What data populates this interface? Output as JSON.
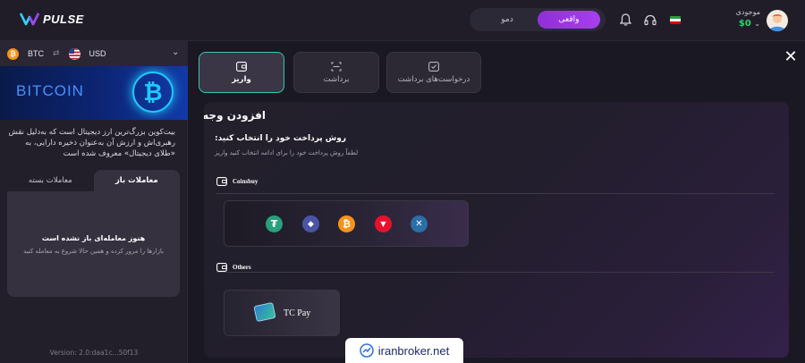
{
  "header": {
    "logo_text": "PULSE",
    "mode_demo": "دمو",
    "mode_real": "واقعی",
    "balance_label": "موجودی",
    "balance_value": "$0"
  },
  "sidebar": {
    "base_coin": "BTC",
    "quote_currency": "USD",
    "banner_title": "BITCOIN",
    "description": "بیت‌کوین بزرگ‌ترین ارز دیجیتال است که به‌دلیل نقش رهبری‌اش و ارزش آن به‌عنوان ذخیره دارایی، به «طلای دیجیتال» معروف شده است",
    "tabs": [
      {
        "label": "معاملات باز",
        "active": true
      },
      {
        "label": "معاملات بسته",
        "active": false
      }
    ],
    "empty_title": "هنوز معامله‌ای باز نشده است",
    "empty_subtitle": "بازارها را مرور کرده و همین حالا شروع به معامله کنید",
    "version": "Version: 2.0:daa1c...50f13"
  },
  "main": {
    "tabs": [
      {
        "label": "واریز",
        "active": true
      },
      {
        "label": "برداشت",
        "active": false
      },
      {
        "label": "درخواست‌های برداشت",
        "active": false
      }
    ],
    "panel_title": "افزودن وجه",
    "panel_subtitle": "روش پرداخت خود را انتخاب کنید:",
    "panel_hint": "لطفاً روش پرداخت خود را برای ادامه انتخاب کنید واریز",
    "sections": [
      {
        "name": "Coinsbuy"
      },
      {
        "name": "Others"
      }
    ],
    "coins": [
      {
        "icon": "tether-icon",
        "glyph": "₮",
        "color": "#26a17b"
      },
      {
        "icon": "ethereum-icon",
        "glyph": "◆",
        "color": "#4a55a8"
      },
      {
        "icon": "bitcoin-icon",
        "glyph": "₿",
        "color": "#f7931a"
      },
      {
        "icon": "tron-icon",
        "glyph": "▼",
        "color": "#e8112d"
      },
      {
        "icon": "ripple-icon",
        "glyph": "✕",
        "color": "#2a6fa8"
      }
    ],
    "tc_pay_label": "TC Pay"
  },
  "watermark": "iranbroker.net",
  "colors": {
    "accent_purple": "#a63ff0",
    "accent_teal": "#39c6b0",
    "balance_green": "#2bd46a"
  }
}
